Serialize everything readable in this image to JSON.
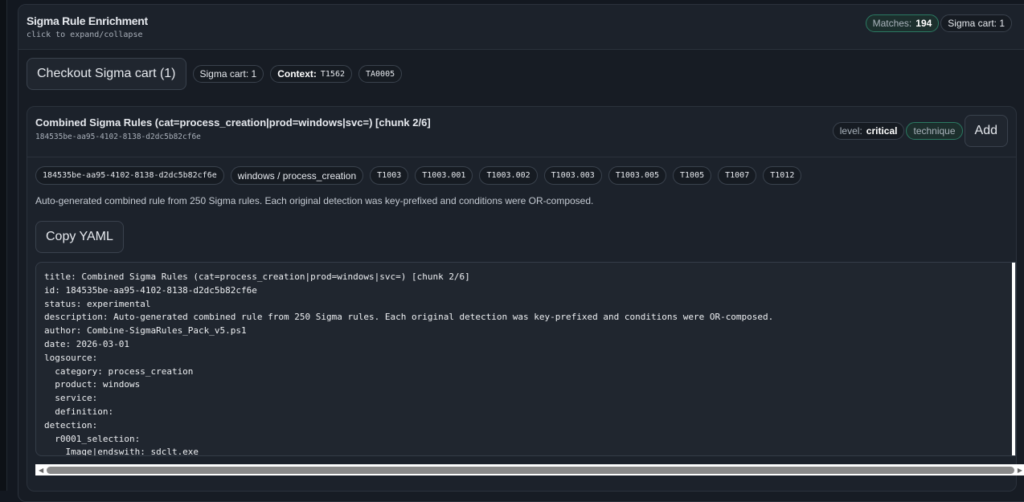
{
  "panel": {
    "title": "Sigma Rule Enrichment",
    "subtitle": "click to expand/collapse",
    "matches_label": "Matches:",
    "matches_value": "194",
    "cart_badge": "Sigma cart: 1"
  },
  "toolbar": {
    "checkout": "Checkout Sigma cart (1)",
    "cart": "Sigma cart: 1",
    "context_label": "Context:",
    "context_value": "T1562",
    "tactic": "TA0005"
  },
  "rule": {
    "title": "Combined Sigma Rules (cat=process_creation|prod=windows|svc=) [chunk 2/6]",
    "id": "184535be-aa95-4102-8138-d2dc5b82cf6e",
    "level_label": "level:",
    "level_value": "critical",
    "type": "technique",
    "add": "Add",
    "tags": [
      "184535be-aa95-4102-8138-d2dc5b82cf6e",
      "windows / process_creation",
      "T1003",
      "T1003.001",
      "T1003.002",
      "T1003.003",
      "T1003.005",
      "T1005",
      "T1007",
      "T1012"
    ],
    "description": "Auto-generated combined rule from 250 Sigma rules. Each original detection was key-prefixed and conditions were OR-composed.",
    "copy": "Copy YAML",
    "yaml": "title: Combined Sigma Rules (cat=process_creation|prod=windows|svc=) [chunk 2/6]\nid: 184535be-aa95-4102-8138-d2dc5b82cf6e\nstatus: experimental\ndescription: Auto-generated combined rule from 250 Sigma rules. Each original detection was key-prefixed and conditions were OR-composed.\nauthor: Combine-SigmaRules_Pack_v5.ps1\ndate: 2026-03-01\nlogsource:\n  category: process_creation\n  product: windows\n  service:\n  definition:\ndetection:\n  r0001_selection:\n    Image|endswith: sdclt.exe"
  }
}
